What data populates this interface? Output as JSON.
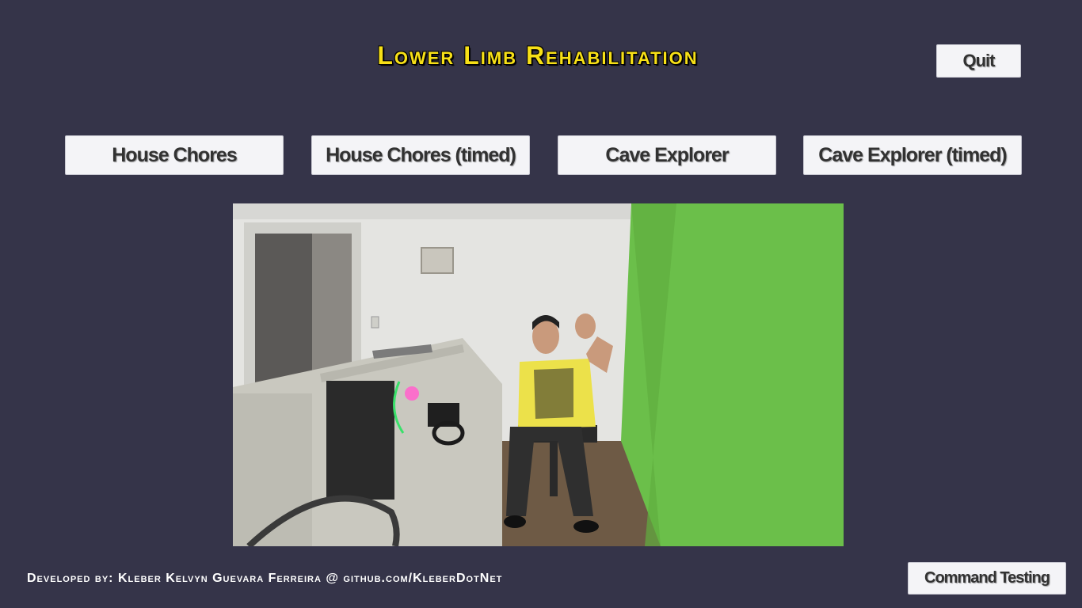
{
  "header": {
    "title": "Lower Limb Rehabilitation",
    "quit_label": "Quit"
  },
  "modes": [
    {
      "label": "House Chores"
    },
    {
      "label": "House Chores (timed)"
    },
    {
      "label": "Cave Explorer"
    },
    {
      "label": "Cave Explorer (timed)"
    }
  ],
  "footer": {
    "credits": "Developed by: Kleber Kelvyn Guevara Ferreira @ github.com/KleberDotNet",
    "command_testing_label": "Command Testing"
  },
  "colors": {
    "background": "#353449",
    "title": "#f7e017",
    "button": "#f4f4f7",
    "button_text": "#323232",
    "wall_green": "#6bbf4a"
  },
  "camera_feed": {
    "icon": "webcam-feed"
  }
}
